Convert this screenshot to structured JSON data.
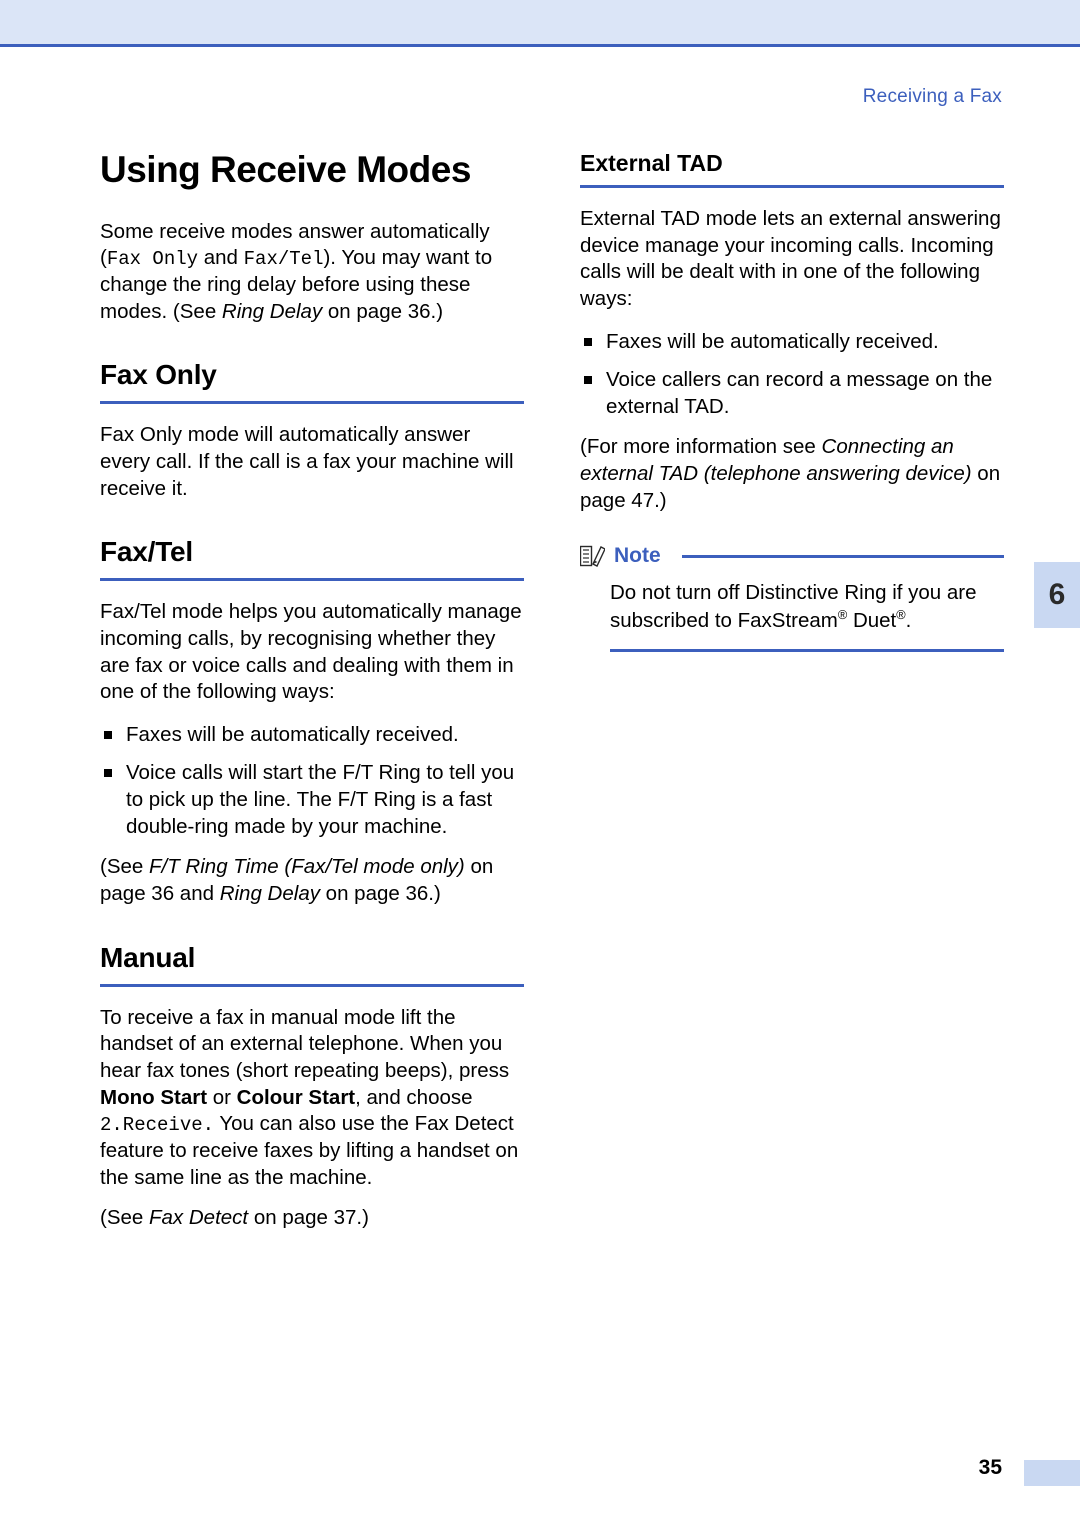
{
  "header": {
    "running_title": "Receiving a Fax",
    "chapter_number": "6"
  },
  "left_column": {
    "title": "Using Receive Modes",
    "intro_1": "Some receive modes answer automatically (",
    "intro_mono_1": "Fax Only",
    "intro_2": " and ",
    "intro_mono_2": "Fax/Tel",
    "intro_3": "). You may want to change the ring delay before using these modes. (See ",
    "intro_italic": "Ring Delay",
    "intro_4": " on page 36.)",
    "fax_only_heading": "Fax Only",
    "fax_only_body": "Fax Only mode will automatically answer every call. If the call is a fax your machine will receive it.",
    "fax_tel_heading": "Fax/Tel",
    "fax_tel_body": "Fax/Tel mode helps you automatically manage incoming calls, by recognising whether they are fax or voice calls and dealing with them in one of the following ways:",
    "fax_tel_bullets": [
      "Faxes will be automatically received.",
      "Voice calls will start the F/T Ring to tell you to pick up the line. The F/T Ring is a fast double-ring made by your machine."
    ],
    "fax_tel_ref_1": "(See ",
    "fax_tel_ref_italic_1": "F/T Ring Time (Fax/Tel mode only)",
    "fax_tel_ref_2": " on page 36 and ",
    "fax_tel_ref_italic_2": "Ring Delay",
    "fax_tel_ref_3": " on page 36.)",
    "manual_heading": "Manual",
    "manual_body_1": "To receive a fax in manual mode lift the handset of an external telephone. When you hear fax tones (short repeating beeps), press ",
    "manual_bold_1": "Mono Start",
    "manual_body_2": " or ",
    "manual_bold_2": "Colour Start",
    "manual_body_3": ", and choose ",
    "manual_mono": "2.Receive.",
    "manual_body_4": " You can also use the Fax Detect feature to receive faxes by lifting a handset on the same line as the machine.",
    "manual_ref_1": "(See ",
    "manual_ref_italic": "Fax Detect",
    "manual_ref_2": " on page 37.)"
  },
  "right_column": {
    "external_tad_heading": "External TAD",
    "external_tad_body": "External TAD mode lets an external answering device manage your incoming calls. Incoming calls will be dealt with in one of the following ways:",
    "external_tad_bullets": [
      "Faxes will be automatically received.",
      "Voice callers can record a message on the external TAD."
    ],
    "external_tad_ref_1": "(For more information see ",
    "external_tad_ref_italic": "Connecting an external TAD (telephone answering device)",
    "external_tad_ref_2": " on page 47.)",
    "note": {
      "label": "Note",
      "body_1": "Do not turn off Distinctive Ring if you are subscribed to FaxStream",
      "sup_1": "®",
      "body_2": " Duet",
      "sup_2": "®",
      "body_3": "."
    }
  },
  "footer": {
    "page_number": "35"
  }
}
